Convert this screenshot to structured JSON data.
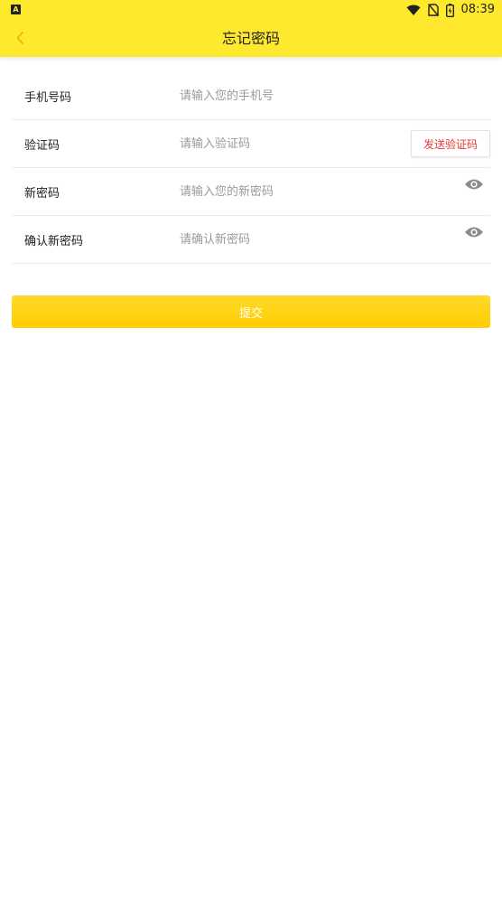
{
  "status_bar": {
    "left_badge": "A",
    "time": "08:39",
    "icons": [
      "wifi-icon",
      "no-sim-icon",
      "battery-icon"
    ]
  },
  "navbar": {
    "title": "忘记密码",
    "back_icon": "chevron-left-icon"
  },
  "form": {
    "phone": {
      "label": "手机号码",
      "placeholder": "请输入您的手机号",
      "value": ""
    },
    "code": {
      "label": "验证码",
      "placeholder": "请输入验证码",
      "value": "",
      "send_label": "发送验证码"
    },
    "new_password": {
      "label": "新密码",
      "placeholder": "请输入您的新密码",
      "value": "",
      "toggle_icon": "eye-icon"
    },
    "confirm_password": {
      "label": "确认新密码",
      "placeholder": "请确认新密码",
      "value": "",
      "toggle_icon": "eye-icon"
    }
  },
  "submit": {
    "label": "提交"
  },
  "colors": {
    "header_bg": "#ffe92f",
    "accent": "#ffcc00",
    "send_code_text": "#e53935",
    "back_arrow": "#f5b400"
  }
}
